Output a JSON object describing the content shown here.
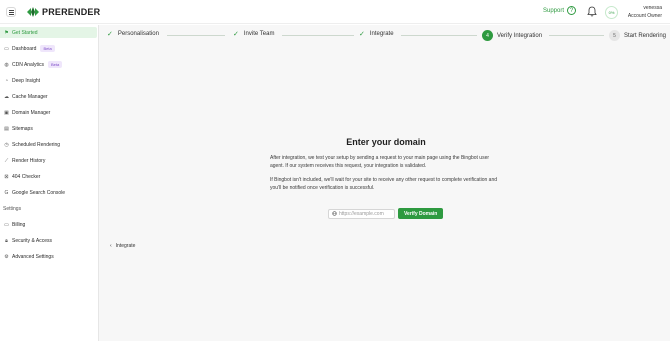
{
  "app": {
    "logo_text": "PRERENDER",
    "support_label": "Support",
    "progress_label": "0%",
    "user_name": "venessa",
    "user_role": "Account Owner"
  },
  "sidebar": {
    "items": [
      {
        "label": "Get Started",
        "icon": "flag-icon"
      },
      {
        "label": "Dashboard",
        "icon": "dashboard-icon",
        "badge": "Beta"
      },
      {
        "label": "CDN Analytics",
        "icon": "globe-icon",
        "badge": "Beta"
      },
      {
        "label": "Deep Insight",
        "icon": "insight-icon"
      },
      {
        "label": "Cache Manager",
        "icon": "cloud-icon"
      },
      {
        "label": "Domain Manager",
        "icon": "monitor-icon"
      },
      {
        "label": "Sitemaps",
        "icon": "sitemap-icon"
      },
      {
        "label": "Scheduled Rendering",
        "icon": "clock-icon"
      },
      {
        "label": "Render History",
        "icon": "chart-icon"
      },
      {
        "label": "404 Checker",
        "icon": "error-icon"
      },
      {
        "label": "Google Search Console",
        "icon": "google-icon"
      }
    ],
    "settings_label": "Settings",
    "settings_items": [
      {
        "label": "Billing",
        "icon": "card-icon"
      },
      {
        "label": "Security & Access",
        "icon": "lock-icon"
      },
      {
        "label": "Advanced Settings",
        "icon": "gear-icon"
      }
    ]
  },
  "stepper": {
    "steps": [
      {
        "label": "Personalisation",
        "state": "done"
      },
      {
        "label": "Invite Team",
        "state": "done"
      },
      {
        "label": "Integrate",
        "state": "done"
      },
      {
        "label": "Verify Integration",
        "state": "current",
        "number": "4"
      },
      {
        "label": "Start Rendering",
        "state": "future",
        "number": "5"
      }
    ]
  },
  "main": {
    "title": "Enter your domain",
    "paragraph1": "After integration, we test your setup by sending a request to your main page using the Bingbot user agent. If our system receives this request, your integration is validated.",
    "paragraph2": "If Bingbot isn't included, we'll wait for your site to receive any other request to complete verification and you'll be notified once verification is successful.",
    "domain_placeholder": "https://example.com",
    "domain_value": "",
    "verify_button": "Verify Domain",
    "back_label": "Integrate"
  },
  "colors": {
    "accent": "#2e9a40",
    "active_bg": "#e4f5e6",
    "badge_bg": "#efe6fb",
    "badge_text": "#7d4cc7"
  }
}
